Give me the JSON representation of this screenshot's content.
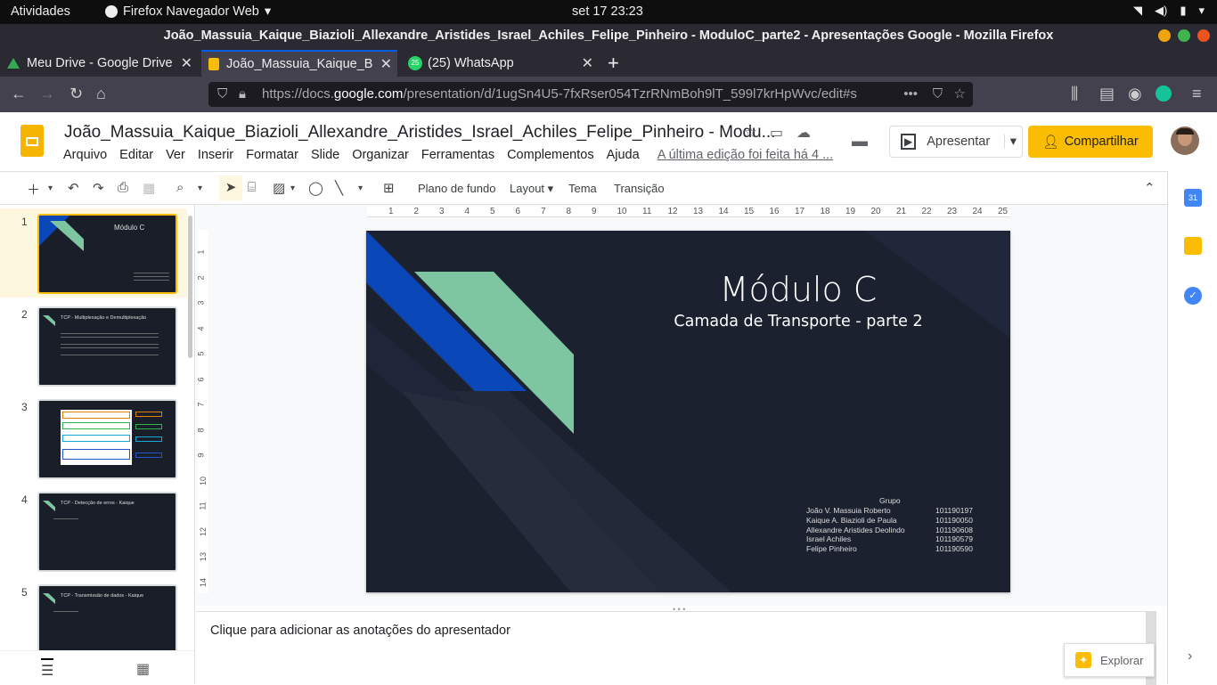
{
  "os_bar": {
    "activities": "Atividades",
    "app_name": "Firefox Navegador Web",
    "clock": "set 17  23:23"
  },
  "window": {
    "title": "João_Massuia_Kaique_Biazioli_Allexandre_Aristides_Israel_Achiles_Felipe_Pinheiro - ModuloC_parte2 - Apresentações Google - Mozilla Firefox"
  },
  "tabs": [
    {
      "label": "Meu Drive - Google Drive"
    },
    {
      "label": "João_Massuia_Kaique_B"
    },
    {
      "label": "(25) WhatsApp",
      "badge": "25"
    }
  ],
  "url": {
    "prefix": "https://docs.",
    "host": "google.com",
    "rest": "/presentation/d/1ugSn4U5-7fxRser054TzrRNmBoh9lT_599l7krHpWvc/edit#s"
  },
  "doc": {
    "title": "João_Massuia_Kaique_Biazioli_Allexandre_Aristides_Israel_Achiles_Felipe_Pinheiro - Modu...",
    "menu": [
      "Arquivo",
      "Editar",
      "Ver",
      "Inserir",
      "Formatar",
      "Slide",
      "Organizar",
      "Ferramentas",
      "Complementos",
      "Ajuda"
    ],
    "last_edit": "A última edição foi feita há 4 ...",
    "present_label": "Apresentar",
    "share_label": "Compartilhar"
  },
  "toolbar": {
    "background": "Plano de fundo",
    "layout": "Layout",
    "theme": "Tema",
    "transition": "Transição"
  },
  "ruler": {
    "h": [
      "1",
      "2",
      "3",
      "4",
      "5",
      "6",
      "7",
      "8",
      "9",
      "10",
      "11",
      "12",
      "13",
      "14",
      "15",
      "16",
      "17",
      "18",
      "19",
      "20",
      "21",
      "22",
      "23",
      "24",
      "25"
    ],
    "v": [
      "1",
      "2",
      "3",
      "4",
      "5",
      "6",
      "7",
      "8",
      "9",
      "10",
      "11",
      "12",
      "13",
      "14"
    ]
  },
  "thumbnails": [
    {
      "num": "1",
      "title": "Módulo C"
    },
    {
      "num": "2",
      "title": "TCP - Multiplexação e Demultiplexação"
    },
    {
      "num": "3",
      "title": ""
    },
    {
      "num": "4",
      "title": "TCP - Detecção de erros - Kaique"
    },
    {
      "num": "5",
      "title": "TCP - Transmissão de dados - Kaique"
    }
  ],
  "slide": {
    "title": "Módulo C",
    "subtitle": "Camada de Transporte - parte 2",
    "group_label": "Grupo",
    "members": [
      {
        "name": "João V. Massuia Roberto",
        "id": "101190197"
      },
      {
        "name": "Kaique A. Biazioli de Paula",
        "id": "101190050"
      },
      {
        "name": "Allexandre Aristides Deolindo",
        "id": "101190608"
      },
      {
        "name": "Israel Achiles",
        "id": "101190579"
      },
      {
        "name": "Felipe Pinheiro",
        "id": "101190590"
      }
    ]
  },
  "notes": {
    "placeholder": "Clique para adicionar as anotações do apresentador"
  },
  "explore_label": "Explorar",
  "colors": {
    "accent_yellow": "#fbbc04",
    "slide_bg": "#1c2130",
    "shape_blue": "#0a47b8",
    "shape_green": "#7ec6a2"
  }
}
